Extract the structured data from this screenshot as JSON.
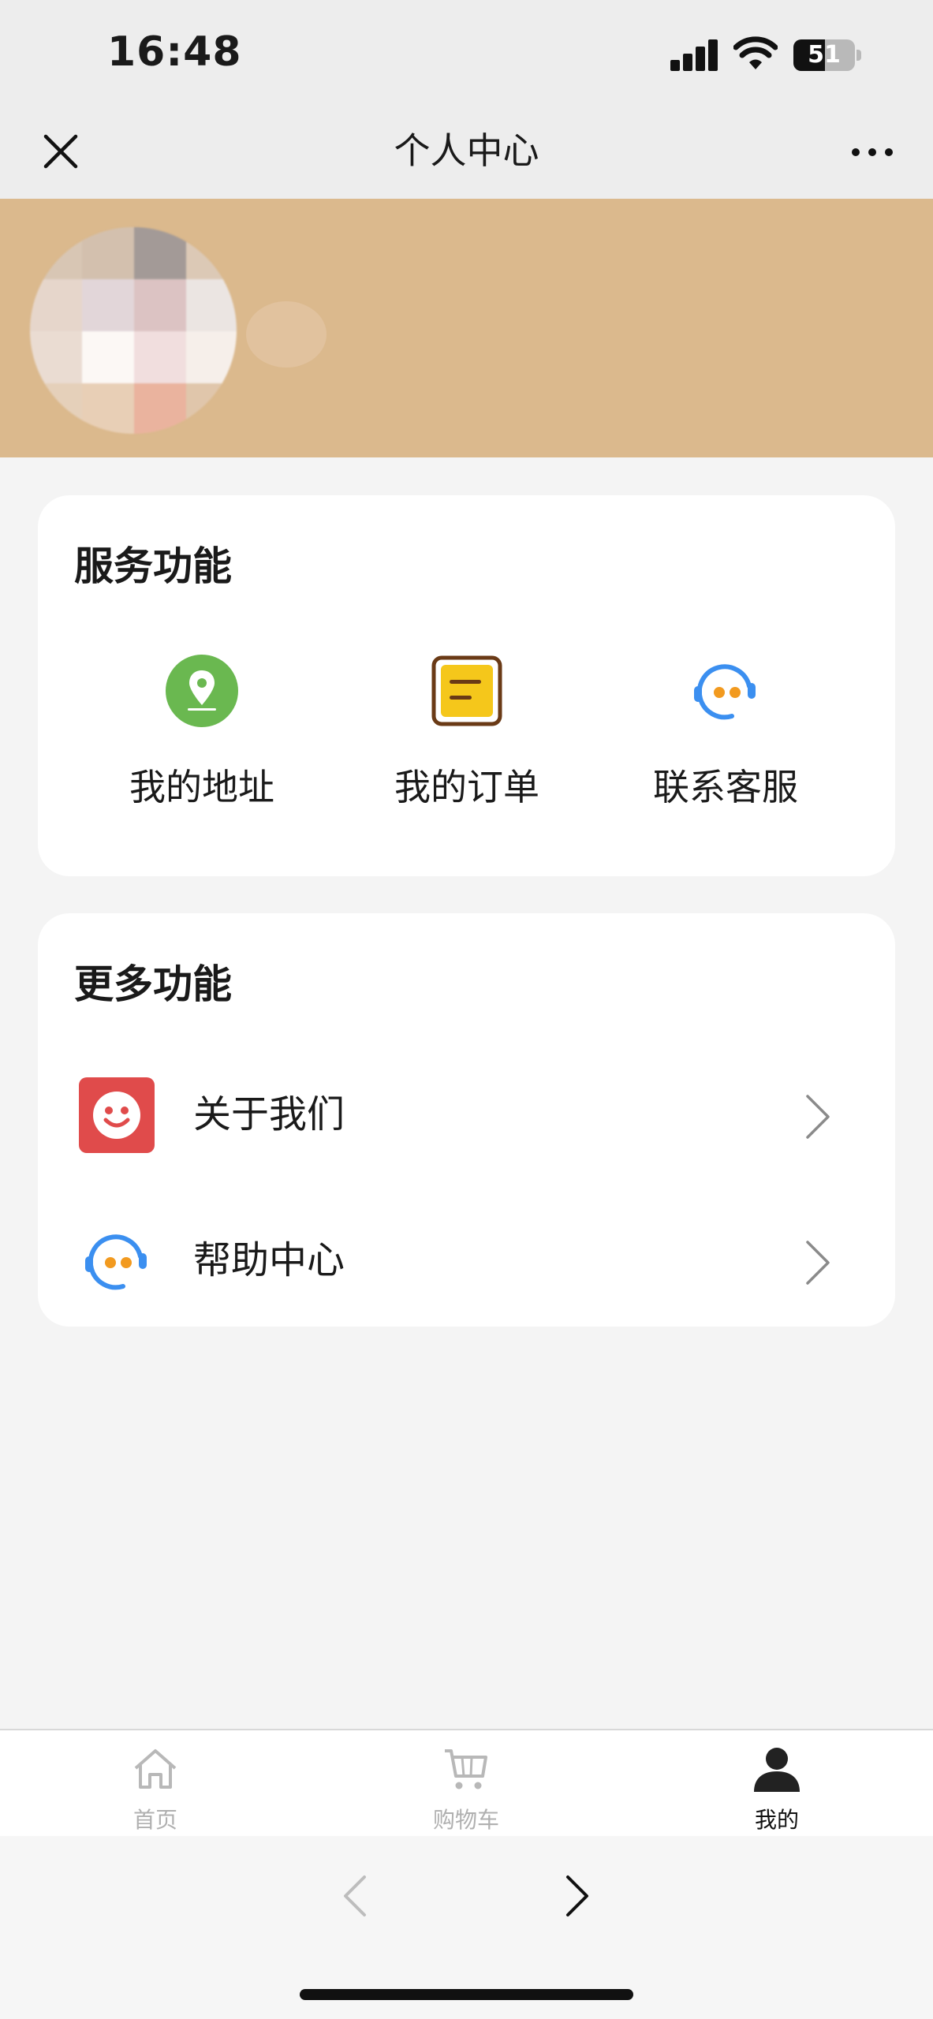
{
  "status_bar": {
    "time": "16:48",
    "battery": "51"
  },
  "nav": {
    "title": "个人中心"
  },
  "service": {
    "title": "服务功能",
    "items": [
      {
        "label": "我的地址",
        "icon": "location-pin-icon"
      },
      {
        "label": "我的订单",
        "icon": "order-note-icon"
      },
      {
        "label": "联系客服",
        "icon": "customer-service-icon"
      }
    ]
  },
  "more": {
    "title": "更多功能",
    "items": [
      {
        "label": "关于我们",
        "icon": "smiley-face-icon"
      },
      {
        "label": "帮助中心",
        "icon": "headset-icon"
      }
    ]
  },
  "tabs": [
    {
      "label": "首页",
      "icon": "home-icon"
    },
    {
      "label": "购物车",
      "icon": "cart-icon"
    },
    {
      "label": "我的",
      "icon": "user-icon"
    }
  ],
  "colors": {
    "header_bg": "#dbb98d",
    "pin_green": "#6ab850",
    "order_yellow": "#f5c71b",
    "order_brown": "#6a3a16",
    "service_blue": "#3b8ff0",
    "service_orange": "#f29a1f",
    "about_red": "#e04b4b"
  }
}
